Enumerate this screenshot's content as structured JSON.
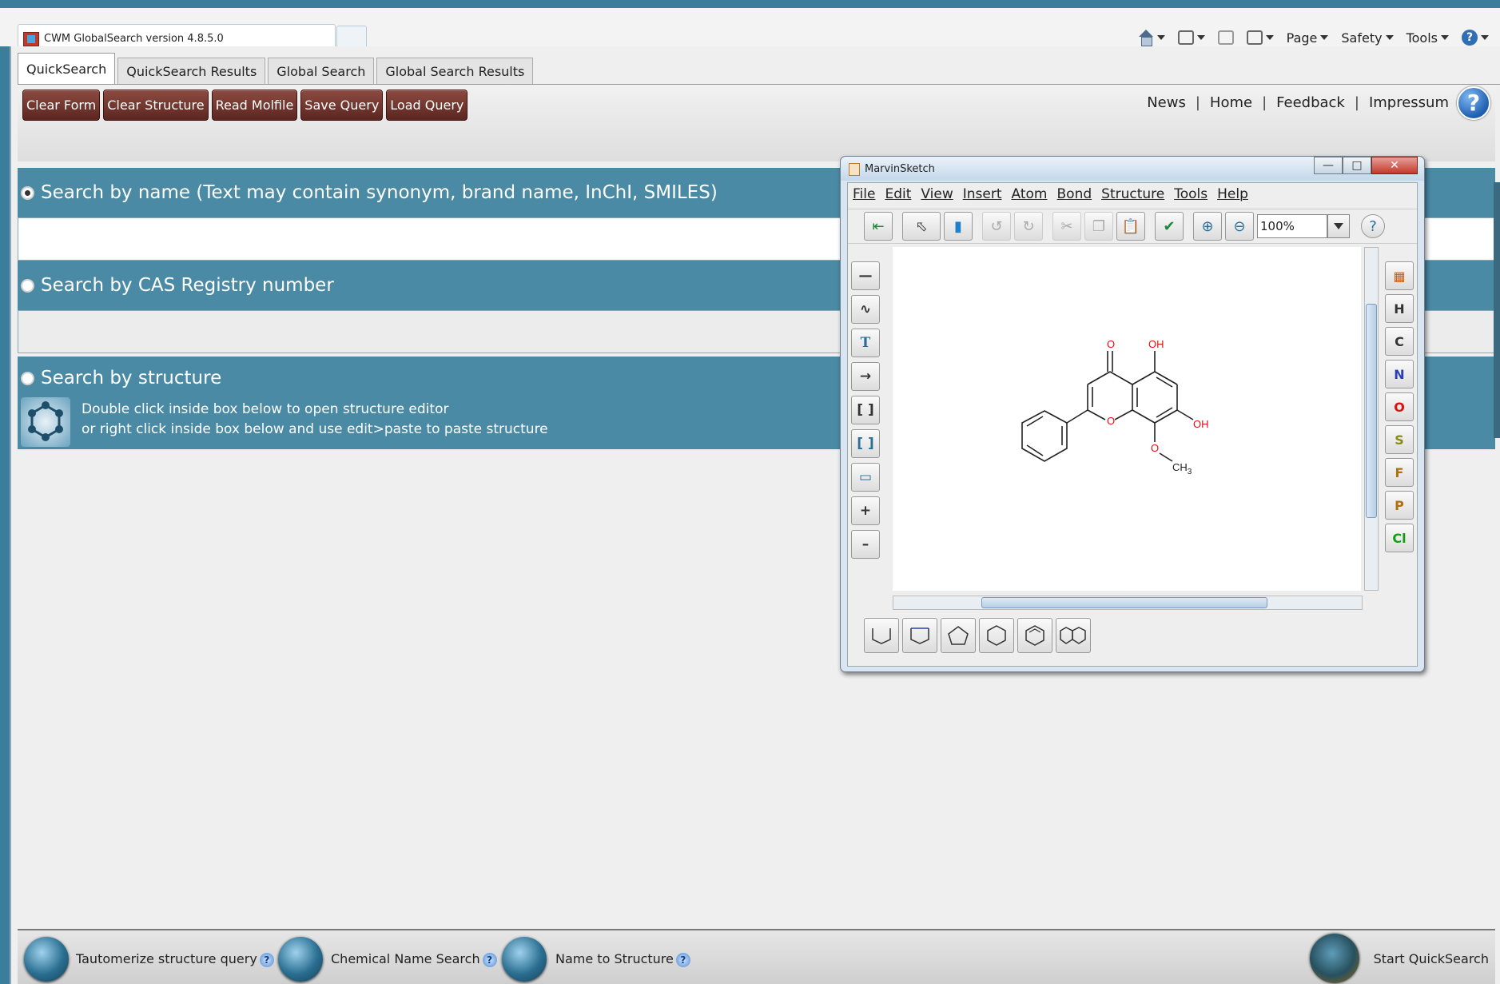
{
  "browser": {
    "tab_title": "CWM GlobalSearch version 4.8.5.0",
    "commands": [
      "Page",
      "Safety",
      "Tools"
    ]
  },
  "tabs": [
    {
      "label": "QuickSearch",
      "active": true
    },
    {
      "label": "QuickSearch Results",
      "active": false
    },
    {
      "label": "Global Search",
      "active": false
    },
    {
      "label": "Global Search Results",
      "active": false
    }
  ],
  "toolbar": {
    "buttons": [
      "Clear Form",
      "Clear Structure",
      "Read Molfile",
      "Save Query",
      "Load Query"
    ],
    "links": [
      "News",
      "Home",
      "Feedback",
      "Impressum"
    ],
    "separator": "|"
  },
  "search": {
    "by_name_label": "Search by name (Text may contain synonym, brand name, InChI, SMILES)",
    "by_name_value": "",
    "by_cas_label": "Search by CAS Registry number",
    "by_cas_value": "",
    "by_structure_label": "Search by structure",
    "structure_hint_1": "Double click inside box below to open structure editor",
    "structure_hint_2": "or right click inside box below and use edit>paste to paste structure"
  },
  "bottom": {
    "option1": "Tautomerize structure query",
    "option2": "Chemical Name Search",
    "option3": "Name to Structure",
    "start": "Start QuickSearch",
    "help_glyph": "?"
  },
  "marvin": {
    "title": "MarvinSketch",
    "menu": [
      "File",
      "Edit",
      "View",
      "Insert",
      "Atom",
      "Bond",
      "Structure",
      "Tools",
      "Help"
    ],
    "zoom": "100%",
    "elements": [
      {
        "symbol": "H",
        "color": "#333333"
      },
      {
        "symbol": "C",
        "color": "#333333"
      },
      {
        "symbol": "N",
        "color": "#2b3fb5"
      },
      {
        "symbol": "O",
        "color": "#e01010"
      },
      {
        "symbol": "S",
        "color": "#8a8a10"
      },
      {
        "symbol": "F",
        "color": "#b07010"
      },
      {
        "symbol": "P",
        "color": "#b07010"
      },
      {
        "symbol": "Cl",
        "color": "#10a010"
      }
    ],
    "molecule_labels": {
      "carbonyl_o": "O",
      "ring_o": "O",
      "oh_top": "OH",
      "oh_right": "OH",
      "methoxy_o": "O",
      "methyl": "CH",
      "methyl_sub": "3"
    }
  }
}
